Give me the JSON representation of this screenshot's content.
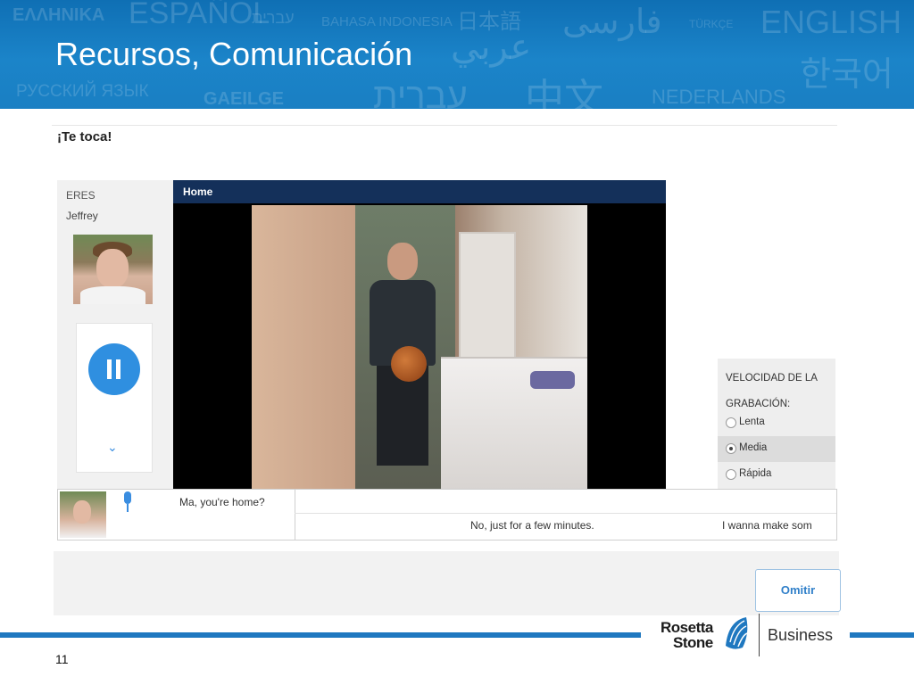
{
  "slide": {
    "title": "Recursos, Comunicación",
    "page_number": "11",
    "banner_words": [
      {
        "text": "ΕΛΛΗΝΙΚΑ"
      },
      {
        "text": "ESPAÑOL"
      },
      {
        "text": "עברית"
      },
      {
        "text": "BAHASA INDONESIA"
      },
      {
        "text": "日本語"
      },
      {
        "text": "فارسی"
      },
      {
        "text": "TÜRKÇE"
      },
      {
        "text": "ENGLISH"
      },
      {
        "text": "عربي"
      },
      {
        "text": "한국어"
      },
      {
        "text": "РУССКИЙ ЯЗЫК"
      },
      {
        "text": "GAEILGE"
      },
      {
        "text": "עברית"
      },
      {
        "text": "中文"
      },
      {
        "text": "NEDERLANDS"
      }
    ]
  },
  "app": {
    "prompt_title": "¡Te toca!",
    "role": {
      "label": "ERES",
      "name": "Jeffrey"
    },
    "video": {
      "title": "Home"
    },
    "speed": {
      "label": "VELOCIDAD DE LA GRABACIÓN:",
      "options": [
        {
          "label": "Lenta",
          "selected": false
        },
        {
          "label": "Media",
          "selected": true
        },
        {
          "label": "Rápida",
          "selected": false
        }
      ]
    },
    "dialog": {
      "line1": "Ma, you're home?",
      "line2": "No, just for a few minutes.",
      "line3": "I wanna make som"
    },
    "skip_button": "Omitir",
    "icons": {
      "pause": "pause-icon",
      "chevron": "chevron-down-icon",
      "mic": "microphone-icon"
    },
    "colors": {
      "accent": "#2f8fe0",
      "video_header": "#14305a",
      "banner": "#1b84c9"
    }
  },
  "logo": {
    "line1": "Rosetta",
    "line2": "Stone",
    "business": "Business"
  }
}
